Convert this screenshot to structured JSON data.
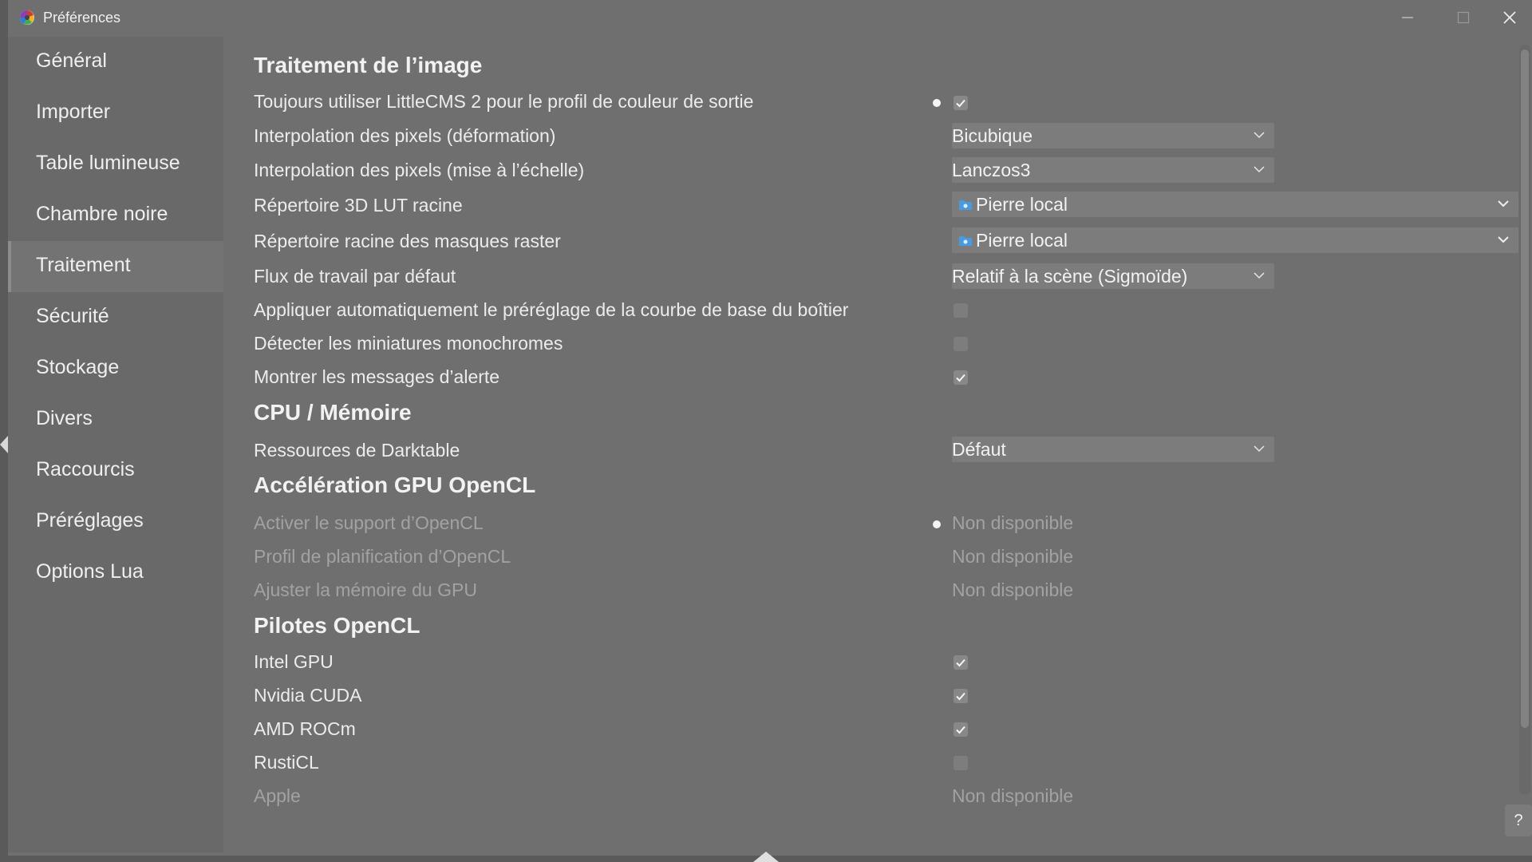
{
  "window": {
    "title": "Préférences"
  },
  "sidebar": {
    "items": [
      {
        "label": "Général"
      },
      {
        "label": "Importer"
      },
      {
        "label": "Table lumineuse"
      },
      {
        "label": "Chambre noire"
      },
      {
        "label": "Traitement",
        "active": true
      },
      {
        "label": "Sécurité"
      },
      {
        "label": "Stockage"
      },
      {
        "label": "Divers"
      },
      {
        "label": "Raccourcis"
      },
      {
        "label": "Préréglages"
      },
      {
        "label": "Options Lua"
      }
    ]
  },
  "sections": {
    "image": {
      "heading": "Traitement de l’image",
      "littlecms": {
        "label": "Toujours utiliser LittleCMS 2 pour le profil de couleur de sortie",
        "checked": true,
        "modified": true
      },
      "interp_warp": {
        "label": "Interpolation des pixels (déformation)",
        "value": "Bicubique"
      },
      "interp_scale": {
        "label": "Interpolation des pixels (mise à l’échelle)",
        "value": "Lanczos3"
      },
      "lut_dir": {
        "label": "Répertoire 3D LUT racine",
        "value": "Pierre local",
        "icon": "folder-icon"
      },
      "raster_dir": {
        "label": "Répertoire racine des masques raster",
        "value": "Pierre local",
        "icon": "folder-icon"
      },
      "workflow": {
        "label": "Flux de travail par défaut",
        "value": "Relatif à la scène (Sigmoïde)"
      },
      "auto_curve": {
        "label": "Appliquer automatiquement le préréglage de la courbe de base du boîtier",
        "checked": false
      },
      "mono_thumbs": {
        "label": "Détecter les miniatures monochromes",
        "checked": false
      },
      "alerts": {
        "label": "Montrer les messages d’alerte",
        "checked": true
      }
    },
    "cpu": {
      "heading": "CPU / Mémoire",
      "resources": {
        "label": "Ressources de Darktable",
        "value": "Défaut"
      }
    },
    "gpu": {
      "heading": "Accélération GPU OpenCL",
      "enable": {
        "label": "Activer le support d’OpenCL",
        "value": "Non disponible",
        "modified": true
      },
      "scheduling": {
        "label": "Profil de planification d’OpenCL",
        "value": "Non disponible"
      },
      "memory": {
        "label": "Ajuster la mémoire du GPU",
        "value": "Non disponible"
      }
    },
    "drivers": {
      "heading": "Pilotes OpenCL",
      "intel": {
        "label": "Intel GPU",
        "checked": true
      },
      "nvidia": {
        "label": "Nvidia CUDA",
        "checked": true
      },
      "amd": {
        "label": "AMD ROCm",
        "checked": true
      },
      "rusticl": {
        "label": "RustiCL",
        "checked": false
      },
      "apple": {
        "label": "Apple",
        "value": "Non disponible"
      }
    }
  },
  "help": {
    "label": "?"
  },
  "colors": {
    "window_bg": "#6f6f6f",
    "sidebar_bg": "#696969",
    "text": "#ececec",
    "disabled_text": "#a2a2a2"
  }
}
